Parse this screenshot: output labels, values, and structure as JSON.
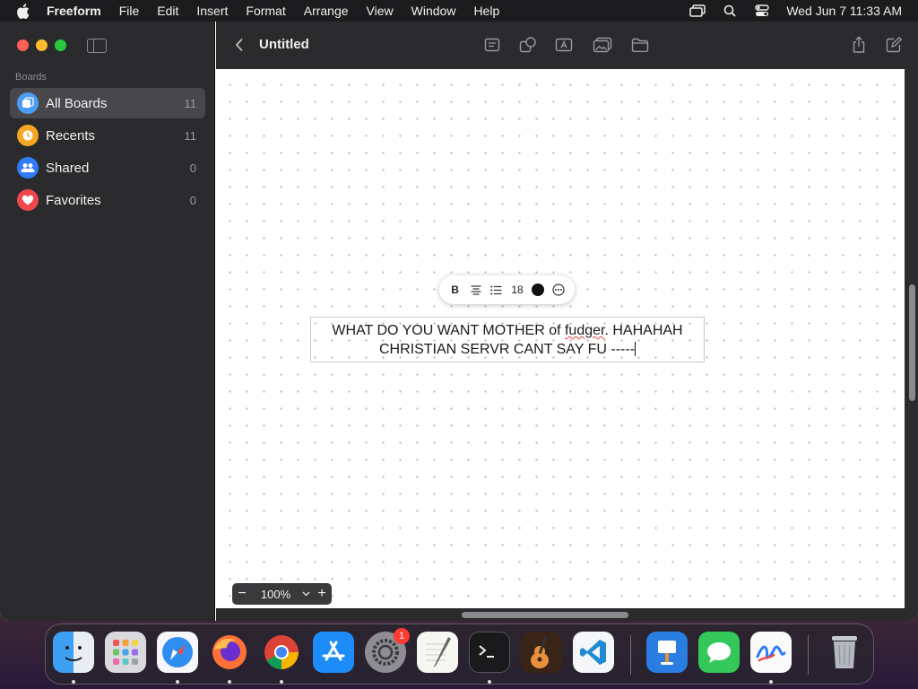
{
  "menubar": {
    "app_name": "Freeform",
    "items": [
      "File",
      "Edit",
      "Insert",
      "Format",
      "Arrange",
      "View",
      "Window",
      "Help"
    ],
    "datetime": "Wed Jun 7  11:33 AM"
  },
  "window": {
    "title": "Untitled"
  },
  "sidebar": {
    "heading": "Boards",
    "items": [
      {
        "label": "All Boards",
        "count": "11",
        "icon": "all-boards-icon",
        "color": "#4a9cf5"
      },
      {
        "label": "Recents",
        "count": "11",
        "icon": "clock-icon",
        "color": "#f5a623"
      },
      {
        "label": "Shared",
        "count": "0",
        "icon": "people-icon",
        "color": "#2f7cf6"
      },
      {
        "label": "Favorites",
        "count": "0",
        "icon": "heart-icon",
        "color": "#f0474e"
      }
    ]
  },
  "format_bar": {
    "bold_label": "B",
    "font_size": "18"
  },
  "textbox": {
    "line1_prefix": "WHAT DO YOU WANT MOTHER of ",
    "line1_misspelled": "fudger",
    "line1_suffix": ". HAHAHAH",
    "line2": "CHRISTIAN SERVR CANT SAY FU -----"
  },
  "zoom": {
    "value": "100%",
    "minus": "−",
    "plus": "+"
  },
  "dock": {
    "system_settings_badge": "1",
    "apps": [
      "finder-icon",
      "launchpad-icon",
      "safari-icon",
      "firefox-icon",
      "chrome-icon",
      "app-store-icon",
      "system-settings-icon",
      "textedit-icon",
      "terminal-icon",
      "garageband-icon",
      "vscode-icon",
      "keynote-icon",
      "messages-icon",
      "freeform-icon",
      "trash-icon"
    ]
  }
}
